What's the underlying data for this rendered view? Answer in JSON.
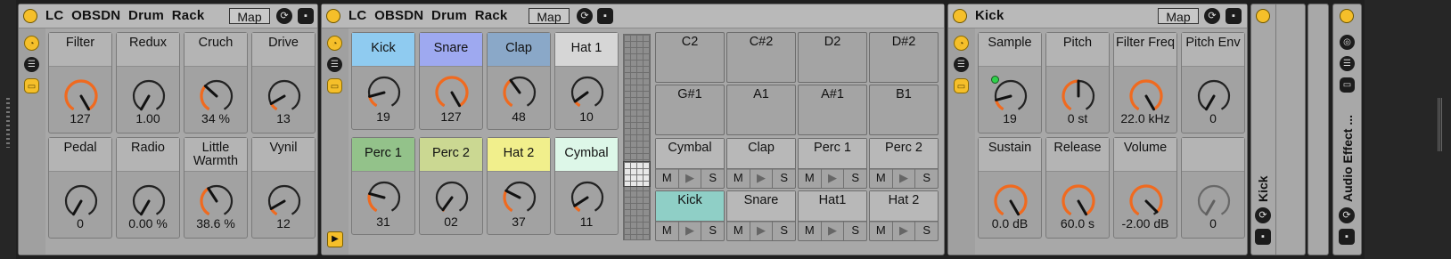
{
  "colors": {
    "accent": "#f5bf2a",
    "knob_arc": "#f06a1f",
    "device_bg": "#a8a8a8"
  },
  "device1": {
    "title": "LC  OBSDN  Drum  Rack",
    "map_label": "Map",
    "macros": [
      {
        "label": "Filter",
        "value": "127",
        "level": 1.0
      },
      {
        "label": "Redux",
        "value": "1.00",
        "level": 0.0
      },
      {
        "label": "Cruch",
        "value": "34 %",
        "level": 0.34
      },
      {
        "label": "Drive",
        "value": "13",
        "level": 0.1
      },
      {
        "label": "Pedal",
        "value": "0",
        "level": 0.0
      },
      {
        "label": "Radio",
        "value": "0.00 %",
        "level": 0.0
      },
      {
        "label": "Little Warmth",
        "value": "38.6 %",
        "level": 0.39
      },
      {
        "label": "Vynil",
        "value": "12",
        "level": 0.1
      }
    ]
  },
  "device2": {
    "title": "LC  OBSDN  Drum  Rack",
    "map_label": "Map",
    "cells": [
      {
        "label": "Kick",
        "value": "19",
        "color": "#8fcbf0",
        "level": 0.15
      },
      {
        "label": "Snare",
        "value": "127",
        "color": "#9ea9f0",
        "level": 1.0
      },
      {
        "label": "Clap",
        "value": "48",
        "color": "#8aa8c8",
        "level": 0.38
      },
      {
        "label": "Hat 1",
        "value": "10",
        "color": "#d6d6d6",
        "level": 0.08
      },
      {
        "label": "Perc 1",
        "value": "31",
        "color": "#93c28a",
        "level": 0.25
      },
      {
        "label": "Perc 2",
        "value": "02",
        "color": "#cbd892",
        "level": 0.02
      },
      {
        "label": "Hat 2",
        "value": "37",
        "color": "#f1ef8c",
        "level": 0.29
      },
      {
        "label": "Cymbal",
        "value": "11",
        "color": "#ddf7e8",
        "level": 0.09
      }
    ],
    "pads_empty": [
      "C2",
      "C#2",
      "D2",
      "D#2",
      "G#1",
      "A1",
      "A#1",
      "B1"
    ],
    "pads_chains": [
      {
        "label": "Cymbal",
        "color": "#b8b8b8"
      },
      {
        "label": "Clap",
        "color": "#b8b8b8"
      },
      {
        "label": "Perc 1",
        "color": "#b8b8b8"
      },
      {
        "label": "Perc 2",
        "color": "#b8b8b8"
      },
      {
        "label": "Kick",
        "color": "#8fcfc6"
      },
      {
        "label": "Snare",
        "color": "#b8b8b8"
      },
      {
        "label": "Hat1",
        "color": "#b8b8b8"
      },
      {
        "label": "Hat 2",
        "color": "#b8b8b8"
      }
    ],
    "pad_controls": [
      "M",
      "▶",
      "S"
    ]
  },
  "device3": {
    "title": "Kick",
    "map_label": "Map",
    "macros": [
      {
        "label": "Sample",
        "value": "19",
        "level": 0.15
      },
      {
        "label": "Pitch",
        "value": "0 st",
        "level": 0.5
      },
      {
        "label": "Filter Freq",
        "value": "22.0 kHz",
        "level": 1.0
      },
      {
        "label": "Pitch Env",
        "value": "0",
        "level": 0.0
      },
      {
        "label": "Sustain",
        "value": "0.0 dB",
        "level": 1.0
      },
      {
        "label": "Release",
        "value": "60.0 s",
        "level": 1.0
      },
      {
        "label": "Volume",
        "value": "-2.00 dB",
        "level": 0.95
      },
      {
        "label": "",
        "value": "0",
        "level": 0.0
      }
    ]
  },
  "folded": {
    "kick_label": "Kick",
    "audio_effect_label": "Audio Effect ..."
  }
}
